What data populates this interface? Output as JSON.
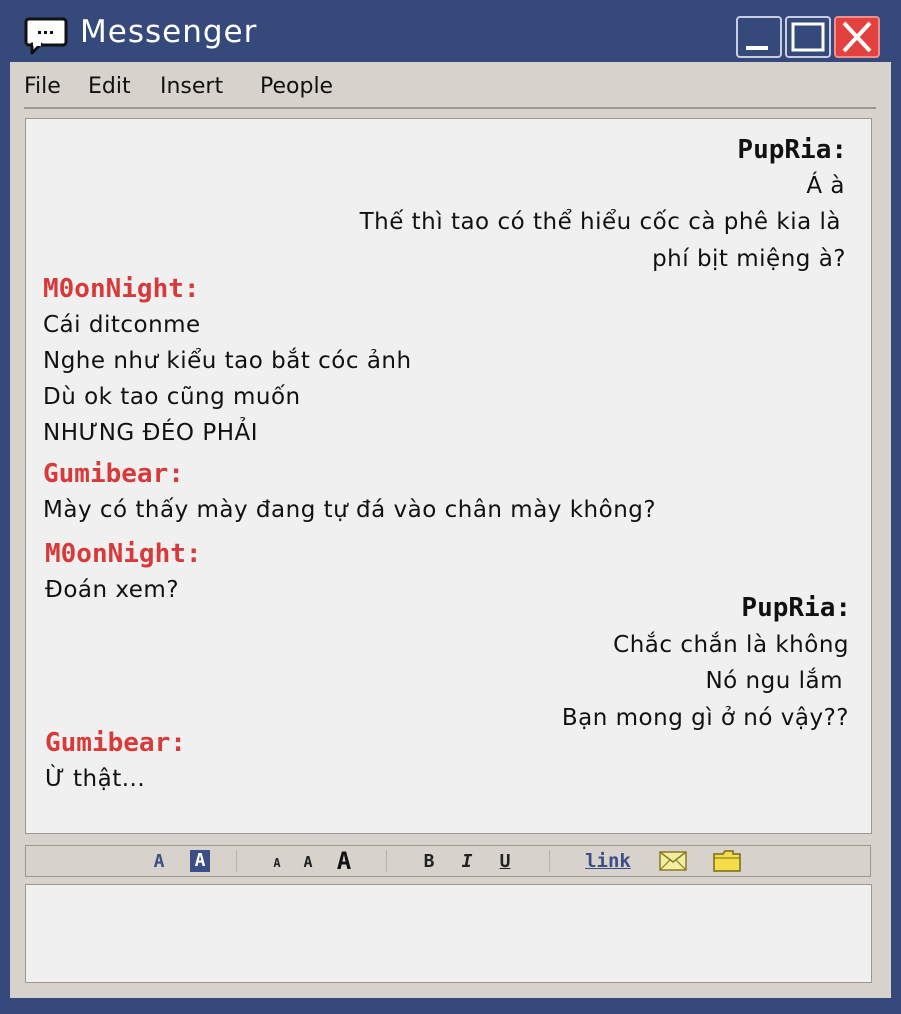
{
  "app": {
    "title": "Messenger",
    "icon": "chat-bubble-icon"
  },
  "window_controls": {
    "minimize_icon": "minimize-icon",
    "maximize_icon": "maximize-icon",
    "close_icon": "close-icon",
    "close_color": "#e3413e"
  },
  "menu": [
    "File",
    "Edit",
    "Insert",
    "People"
  ],
  "colors": {
    "titlebar": "#35497a",
    "window": "#d7d3cc",
    "chat_bg": "#f0f0f0",
    "name_red": "#d83a3a",
    "toolbar_blue": "#3b4f86"
  },
  "chat": {
    "messages": [
      {
        "sender": "PupRia:",
        "align": "right",
        "lines": [
          "Á à",
          "Thế thì tao có thể hiểu cốc cà phê kia là",
          "phí bịt miệng à?"
        ]
      },
      {
        "sender": "M0onNight:",
        "align": "left",
        "lines": [
          "Cái ditconme",
          "Nghe như kiểu tao bắt cóc ảnh",
          "Dù ok tao cũng muốn",
          "NHƯNG ĐÉO PHẢI"
        ]
      },
      {
        "sender": "Gumibear:",
        "align": "left",
        "lines": [
          "Mày có thấy mày đang tự đá vào chân mày không?"
        ]
      },
      {
        "sender": "M0onNight:",
        "align": "left",
        "lines": [
          "Đoán xem?"
        ]
      },
      {
        "sender": "PupRia:",
        "align": "right",
        "lines": [
          "Chắc chắn là không",
          "Nó ngu lắm",
          "Bạn mong gì ở nó vậy??"
        ]
      },
      {
        "sender": "Gumibear:",
        "align": "left",
        "lines": [
          "Ừ thật..."
        ]
      }
    ]
  },
  "toolbar": {
    "font_color_label": "A",
    "highlight_label": "A",
    "size_small_label": "A",
    "size_medium_label": "A",
    "size_large_label": "A",
    "bold_label": "B",
    "italic_label": "I",
    "underline_label": "U",
    "link_label": "link",
    "email_icon": "envelope-icon",
    "folder_icon": "folder-icon"
  },
  "input": {
    "value": ""
  }
}
